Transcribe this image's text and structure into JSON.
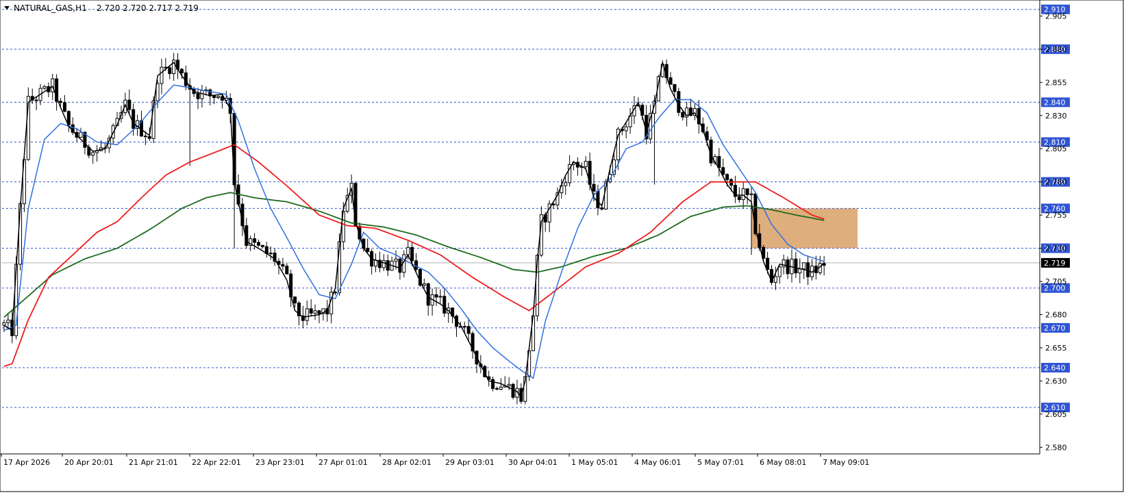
{
  "header": {
    "menu_triangle": "dropdown-triangle-icon",
    "title": "NATURAL_GAS,H1",
    "ohlc": "2.720 2.720 2.717 2.719"
  },
  "colors": {
    "background": "#ffffff",
    "candle": "#000000",
    "ma_fast": "#000000",
    "ma_mid": "#2f6fe0",
    "ma_red": "#ee1c1c",
    "ma_green": "#1c6b1c",
    "level_line": "#3355cc",
    "level_label_bg": "#2f55d4",
    "current_label_bg": "#000000",
    "zone": "#d9a066"
  },
  "chart_data": {
    "type": "candlestick",
    "symbol": "NATURAL_GAS",
    "timeframe": "H1",
    "ylim": [
      2.575,
      2.915
    ],
    "y_ticks": [
      "2.905",
      "2.880",
      "2.855",
      "2.830",
      "2.805",
      "2.780",
      "2.755",
      "2.730",
      "2.705",
      "2.680",
      "2.655",
      "2.630",
      "2.605",
      "2.580"
    ],
    "x_ticks": [
      "17 Apr 2026",
      "20 Apr 20:01",
      "21 Apr 21:01",
      "22 Apr 22:01",
      "23 Apr 23:01",
      "27 Apr 01:01",
      "28 Apr 02:01",
      "29 Apr 03:01",
      "30 Apr 04:01",
      "1 May 05:01",
      "4 May 06:01",
      "5 May 07:01",
      "6 May 08:01",
      "7 May 09:01"
    ],
    "levels": [
      "2.910",
      "2.880",
      "2.840",
      "2.810",
      "2.780",
      "2.760",
      "2.730",
      "2.700",
      "2.670",
      "2.640",
      "2.610"
    ],
    "current_price": "2.719",
    "zone": {
      "top": 2.76,
      "bottom": 2.73,
      "start_bar": 185,
      "end_bar": 208
    },
    "price_path": [
      [
        0,
        2.672
      ],
      [
        2,
        2.668
      ],
      [
        4,
        2.76
      ],
      [
        6,
        2.84
      ],
      [
        10,
        2.848
      ],
      [
        12,
        2.852
      ],
      [
        14,
        2.836
      ],
      [
        16,
        2.822
      ],
      [
        18,
        2.815
      ],
      [
        22,
        2.803
      ],
      [
        25,
        2.805
      ],
      [
        28,
        2.823
      ],
      [
        30,
        2.838
      ],
      [
        32,
        2.824
      ],
      [
        36,
        2.815
      ],
      [
        38,
        2.86
      ],
      [
        42,
        2.87
      ],
      [
        44,
        2.86
      ],
      [
        47,
        2.848
      ],
      [
        51,
        2.845
      ],
      [
        54,
        2.846
      ],
      [
        56,
        2.835
      ],
      [
        57,
        2.78
      ],
      [
        60,
        2.735
      ],
      [
        63,
        2.73
      ],
      [
        67,
        2.722
      ],
      [
        70,
        2.706
      ],
      [
        72,
        2.683
      ],
      [
        74,
        2.678
      ],
      [
        78,
        2.68
      ],
      [
        80,
        2.683
      ],
      [
        82,
        2.7
      ],
      [
        84,
        2.76
      ],
      [
        86,
        2.775
      ],
      [
        87,
        2.75
      ],
      [
        89,
        2.73
      ],
      [
        91,
        2.722
      ],
      [
        95,
        2.718
      ],
      [
        98,
        2.715
      ],
      [
        100,
        2.725
      ],
      [
        103,
        2.705
      ],
      [
        105,
        2.693
      ],
      [
        108,
        2.688
      ],
      [
        110,
        2.683
      ],
      [
        113,
        2.672
      ],
      [
        115,
        2.66
      ],
      [
        118,
        2.642
      ],
      [
        120,
        2.63
      ],
      [
        123,
        2.628
      ],
      [
        125,
        2.625
      ],
      [
        127,
        2.622
      ],
      [
        128,
        2.618
      ],
      [
        129,
        2.63
      ],
      [
        131,
        2.68
      ],
      [
        132,
        2.72
      ],
      [
        133,
        2.75
      ],
      [
        135,
        2.76
      ],
      [
        137,
        2.77
      ],
      [
        139,
        2.785
      ],
      [
        141,
        2.795
      ],
      [
        144,
        2.79
      ],
      [
        146,
        2.768
      ],
      [
        148,
        2.762
      ],
      [
        150,
        2.79
      ],
      [
        152,
        2.815
      ],
      [
        155,
        2.83
      ],
      [
        157,
        2.84
      ],
      [
        159,
        2.818
      ],
      [
        161,
        2.838
      ],
      [
        163,
        2.87
      ],
      [
        165,
        2.85
      ],
      [
        167,
        2.838
      ],
      [
        169,
        2.83
      ],
      [
        171,
        2.832
      ],
      [
        173,
        2.82
      ],
      [
        175,
        2.8
      ],
      [
        177,
        2.79
      ],
      [
        179,
        2.778
      ],
      [
        181,
        2.77
      ],
      [
        183,
        2.77
      ],
      [
        185,
        2.765
      ],
      [
        186,
        2.745
      ],
      [
        188,
        2.72
      ],
      [
        190,
        2.705
      ],
      [
        192,
        2.718
      ],
      [
        195,
        2.716
      ],
      [
        198,
        2.714
      ],
      [
        200,
        2.712
      ],
      [
        202,
        2.716
      ],
      [
        203,
        2.719
      ]
    ],
    "ma_red_path": [
      [
        0,
        2.641
      ],
      [
        2,
        2.643
      ],
      [
        6,
        2.676
      ],
      [
        11,
        2.708
      ],
      [
        17,
        2.725
      ],
      [
        23,
        2.742
      ],
      [
        28,
        2.75
      ],
      [
        34,
        2.768
      ],
      [
        40,
        2.785
      ],
      [
        46,
        2.795
      ],
      [
        52,
        2.802
      ],
      [
        57,
        2.808
      ],
      [
        63,
        2.795
      ],
      [
        70,
        2.777
      ],
      [
        78,
        2.755
      ],
      [
        85,
        2.747
      ],
      [
        92,
        2.745
      ],
      [
        100,
        2.736
      ],
      [
        108,
        2.725
      ],
      [
        116,
        2.708
      ],
      [
        124,
        2.693
      ],
      [
        130,
        2.683
      ],
      [
        136,
        2.697
      ],
      [
        144,
        2.716
      ],
      [
        152,
        2.726
      ],
      [
        160,
        2.742
      ],
      [
        168,
        2.765
      ],
      [
        175,
        2.78
      ],
      [
        181,
        2.78
      ],
      [
        186,
        2.78
      ],
      [
        193,
        2.768
      ],
      [
        200,
        2.755
      ],
      [
        203,
        2.752
      ]
    ],
    "ma_green_path": [
      [
        0,
        2.678
      ],
      [
        6,
        2.694
      ],
      [
        12,
        2.71
      ],
      [
        20,
        2.722
      ],
      [
        28,
        2.73
      ],
      [
        36,
        2.744
      ],
      [
        44,
        2.76
      ],
      [
        50,
        2.768
      ],
      [
        56,
        2.772
      ],
      [
        62,
        2.768
      ],
      [
        70,
        2.765
      ],
      [
        78,
        2.758
      ],
      [
        86,
        2.749
      ],
      [
        94,
        2.746
      ],
      [
        102,
        2.74
      ],
      [
        110,
        2.731
      ],
      [
        118,
        2.723
      ],
      [
        126,
        2.714
      ],
      [
        132,
        2.712
      ],
      [
        138,
        2.716
      ],
      [
        146,
        2.724
      ],
      [
        154,
        2.73
      ],
      [
        162,
        2.74
      ],
      [
        170,
        2.754
      ],
      [
        178,
        2.761
      ],
      [
        184,
        2.762
      ],
      [
        190,
        2.759
      ],
      [
        196,
        2.755
      ],
      [
        203,
        2.751
      ]
    ],
    "ma_mid_path": [
      [
        0,
        2.668
      ],
      [
        3,
        2.672
      ],
      [
        6,
        2.76
      ],
      [
        10,
        2.812
      ],
      [
        14,
        2.824
      ],
      [
        18,
        2.82
      ],
      [
        23,
        2.81
      ],
      [
        28,
        2.808
      ],
      [
        33,
        2.822
      ],
      [
        38,
        2.84
      ],
      [
        42,
        2.853
      ],
      [
        46,
        2.851
      ],
      [
        51,
        2.848
      ],
      [
        55,
        2.846
      ],
      [
        58,
        2.826
      ],
      [
        62,
        2.79
      ],
      [
        66,
        2.76
      ],
      [
        70,
        2.738
      ],
      [
        74,
        2.715
      ],
      [
        78,
        2.695
      ],
      [
        82,
        2.692
      ],
      [
        86,
        2.718
      ],
      [
        89,
        2.742
      ],
      [
        93,
        2.73
      ],
      [
        97,
        2.725
      ],
      [
        101,
        2.718
      ],
      [
        105,
        2.712
      ],
      [
        109,
        2.7
      ],
      [
        113,
        2.685
      ],
      [
        117,
        2.668
      ],
      [
        121,
        2.655
      ],
      [
        125,
        2.645
      ],
      [
        128,
        2.638
      ],
      [
        131,
        2.632
      ],
      [
        134,
        2.675
      ],
      [
        138,
        2.712
      ],
      [
        142,
        2.745
      ],
      [
        146,
        2.77
      ],
      [
        150,
        2.782
      ],
      [
        154,
        2.805
      ],
      [
        158,
        2.81
      ],
      [
        162,
        2.828
      ],
      [
        166,
        2.842
      ],
      [
        170,
        2.842
      ],
      [
        174,
        2.832
      ],
      [
        178,
        2.808
      ],
      [
        182,
        2.79
      ],
      [
        186,
        2.772
      ],
      [
        190,
        2.748
      ],
      [
        194,
        2.733
      ],
      [
        198,
        2.725
      ],
      [
        203,
        2.72
      ]
    ]
  }
}
